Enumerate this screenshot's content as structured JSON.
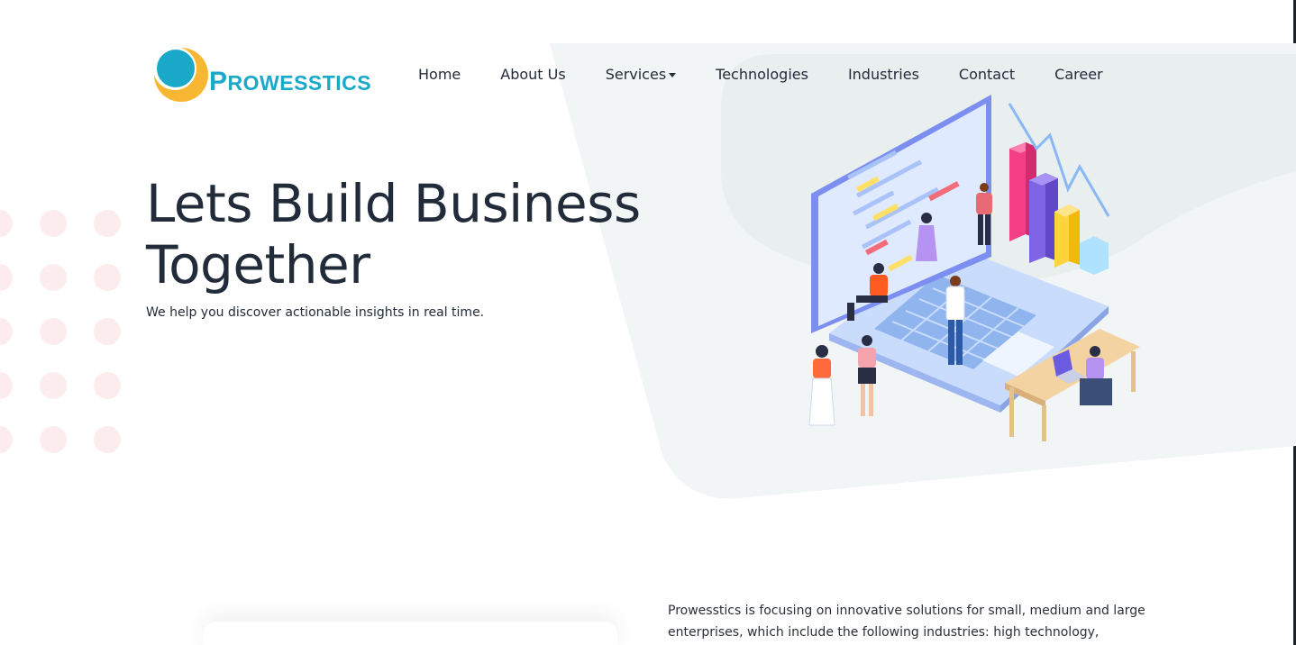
{
  "brand": {
    "name_first_letter": "P",
    "name_rest": "ROWESSTICS",
    "logo_icon": "circle-sun-logo-icon",
    "primary_color": "#1ba9c9",
    "accent_color": "#f7b733"
  },
  "nav": {
    "items": [
      {
        "label": "Home"
      },
      {
        "label": "About Us"
      },
      {
        "label": "Services",
        "dropdown": true
      },
      {
        "label": "Technologies"
      },
      {
        "label": "Industries"
      },
      {
        "label": "Contact"
      },
      {
        "label": "Career"
      }
    ]
  },
  "hero": {
    "title": "Lets Build Business Together",
    "subtitle": "We help you discover actionable insights in real time.",
    "illustration_icon": "team-laptop-analytics-illustration"
  },
  "about": {
    "text": "Prowesstics is focusing on innovative solutions for small, medium and large enterprises, which include the following industries: high technology,"
  },
  "colors": {
    "heading": "#222b3a",
    "hero_bg_shape": "#f1f4f4",
    "dot_pattern": "#fdeced"
  }
}
